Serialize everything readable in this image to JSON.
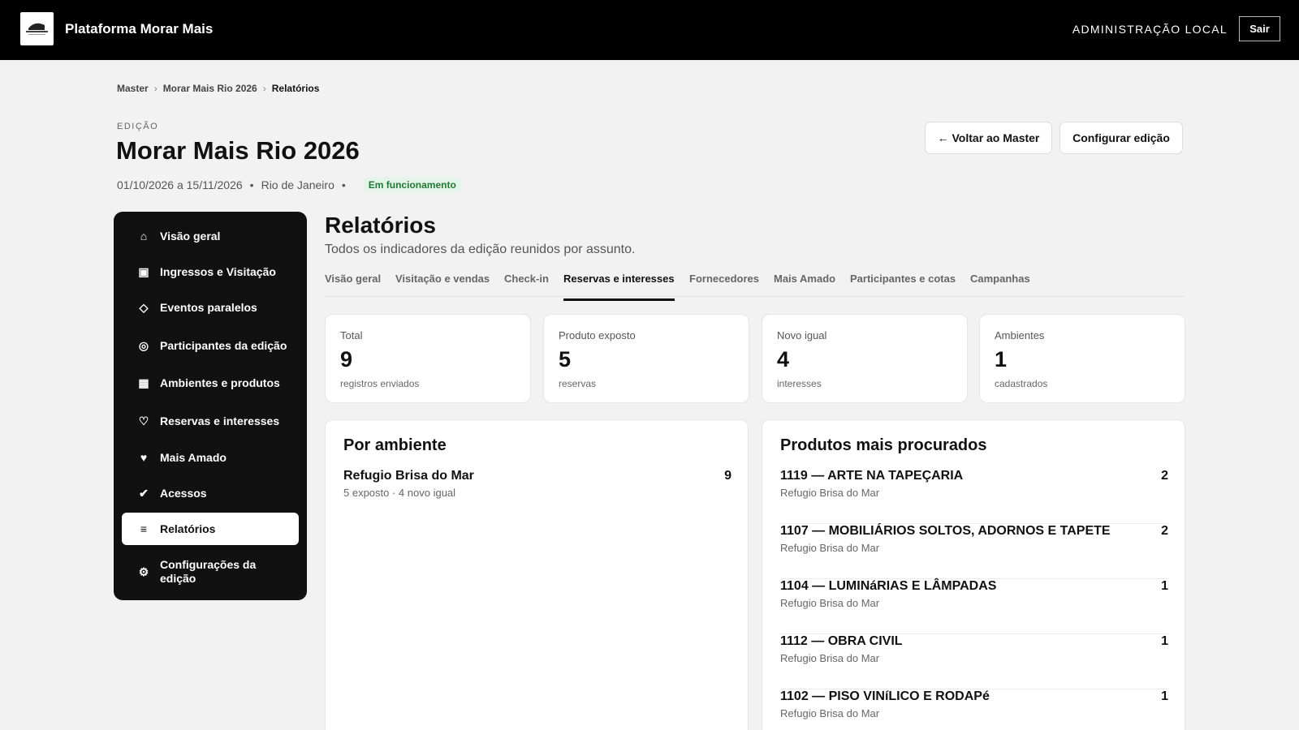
{
  "app": {
    "title": "Plataforma Morar Mais",
    "admin_label": "ADMINISTRAÇÃO LOCAL",
    "logout_label": "Sair"
  },
  "breadcrumb": [
    "Master",
    "Morar Mais Rio 2026",
    "Relatórios"
  ],
  "edition": {
    "eyebrow": "EDIÇÃO",
    "title": "Morar Mais Rio 2026",
    "dates": "01/10/2026 a 15/11/2026",
    "city": "Rio de Janeiro",
    "status": "Em funcionamento",
    "back_label": "← Voltar ao Master",
    "config_label": "Configurar edição"
  },
  "sidebar": {
    "items": [
      {
        "label": "Visão geral",
        "icon": "home-icon",
        "glyph": "⌂"
      },
      {
        "label": "Ingressos e Visitação",
        "icon": "ticket-icon",
        "glyph": "▣"
      },
      {
        "label": "Eventos paralelos",
        "icon": "diamond-icon",
        "glyph": "◇"
      },
      {
        "label": "Participantes da edição",
        "icon": "circle-icon",
        "glyph": "◎"
      },
      {
        "label": "Ambientes e produtos",
        "icon": "grid-icon",
        "glyph": "▦"
      },
      {
        "label": "Reservas e interesses",
        "icon": "heart-outline-icon",
        "glyph": "♡"
      },
      {
        "label": "Mais Amado",
        "icon": "heart-icon",
        "glyph": "♥"
      },
      {
        "label": "Acessos",
        "icon": "check-icon",
        "glyph": "✔"
      },
      {
        "label": "Relatórios",
        "icon": "list-icon",
        "glyph": "≡"
      },
      {
        "label": "Configurações da edição",
        "icon": "gear-icon",
        "glyph": "⚙"
      }
    ],
    "active_index": 8
  },
  "reports": {
    "title": "Relatórios",
    "subtitle": "Todos os indicadores da edição reunidos por assunto.",
    "tabs": [
      "Visão geral",
      "Visitação e vendas",
      "Check-in",
      "Reservas e interesses",
      "Fornecedores",
      "Mais Amado",
      "Participantes e cotas",
      "Campanhas"
    ],
    "active_tab": 3
  },
  "stats": [
    {
      "label": "Total",
      "value": "9",
      "caption": "registros enviados"
    },
    {
      "label": "Produto exposto",
      "value": "5",
      "caption": "reservas"
    },
    {
      "label": "Novo igual",
      "value": "4",
      "caption": "interesses"
    },
    {
      "label": "Ambientes",
      "value": "1",
      "caption": "cadastrados"
    }
  ],
  "by_environment": {
    "title": "Por ambiente",
    "rows": [
      {
        "name": "Refugio Brisa do Mar",
        "sub": "5 exposto · 4 novo igual",
        "count": "9"
      }
    ]
  },
  "top_products": {
    "title": "Produtos mais procurados",
    "rows": [
      {
        "name": "1119 — ARTE NA TAPEÇARIA",
        "sub": "Refugio Brisa do Mar",
        "count": "2"
      },
      {
        "name": "1107 — MOBILIÁRIOS SOLTOS, ADORNOS E TAPETE",
        "sub": "Refugio Brisa do Mar",
        "count": "2"
      },
      {
        "name": "1104 — LUMINáRIAS E LÂMPADAS",
        "sub": "Refugio Brisa do Mar",
        "count": "1"
      },
      {
        "name": "1112 — OBRA CIVIL",
        "sub": "Refugio Brisa do Mar",
        "count": "1"
      },
      {
        "name": "1102 — PISO VINíLICO E RODAPé",
        "sub": "Refugio Brisa do Mar",
        "count": "1"
      }
    ]
  }
}
